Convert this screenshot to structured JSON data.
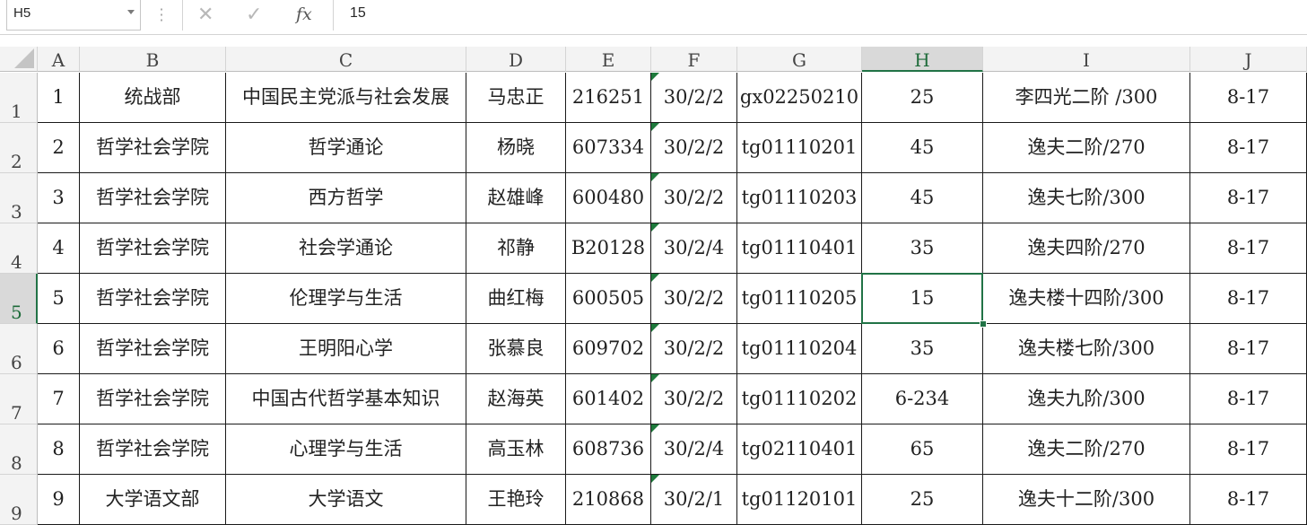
{
  "formula_bar": {
    "name_box": "H5",
    "formula": "15",
    "cancel_glyph": "✕",
    "enter_glyph": "✓",
    "fx_label": "fx"
  },
  "column_headers": [
    "A",
    "B",
    "C",
    "D",
    "E",
    "F",
    "G",
    "H",
    "I",
    "J"
  ],
  "row_headers": [
    "1",
    "2",
    "3",
    "4",
    "5",
    "6",
    "7",
    "8",
    "9"
  ],
  "rows": [
    [
      "1",
      "统战部",
      "中国民主党派与社会发展",
      "马忠正",
      "216251",
      "30/2/2",
      "gx02250210",
      "25",
      "李四光二阶 /300",
      "8-17"
    ],
    [
      "2",
      "哲学社会学院",
      "哲学通论",
      "杨晓",
      "607334",
      "30/2/2",
      "tg01110201",
      "45",
      "逸夫二阶/270",
      "8-17"
    ],
    [
      "3",
      "哲学社会学院",
      "西方哲学",
      "赵雄峰",
      "600480",
      "30/2/2",
      "tg01110203",
      "45",
      "逸夫七阶/300",
      "8-17"
    ],
    [
      "4",
      "哲学社会学院",
      "社会学通论",
      "祁静",
      "B20128",
      "30/2/4",
      "tg01110401",
      "35",
      "逸夫四阶/270",
      "8-17"
    ],
    [
      "5",
      "哲学社会学院",
      "伦理学与生活",
      "曲红梅",
      "600505",
      "30/2/2",
      "tg01110205",
      "15",
      "逸夫楼十四阶/300",
      "8-17"
    ],
    [
      "6",
      "哲学社会学院",
      "王明阳心学",
      "张慕良",
      "609702",
      "30/2/2",
      "tg01110204",
      "35",
      "逸夫楼七阶/300",
      "8-17"
    ],
    [
      "7",
      "哲学社会学院",
      "中国古代哲学基本知识",
      "赵海英",
      "601402",
      "30/2/2",
      "tg01110202",
      "6-234",
      "逸夫九阶/300",
      "8-17"
    ],
    [
      "8",
      "哲学社会学院",
      "心理学与生活",
      "高玉林",
      "608736",
      "30/2/4",
      "tg02110401",
      "65",
      "逸夫二阶/270",
      "8-17"
    ],
    [
      "9",
      "大学语文部",
      "大学语文",
      "王艳玲",
      "210868",
      "30/2/1",
      "tg01120101",
      "25",
      "逸夫十二阶/300",
      "8-17"
    ]
  ],
  "active_cell": {
    "col": "H",
    "row": "5"
  },
  "colors": {
    "accent": "#217346",
    "indicator": "#1e7a3c"
  }
}
